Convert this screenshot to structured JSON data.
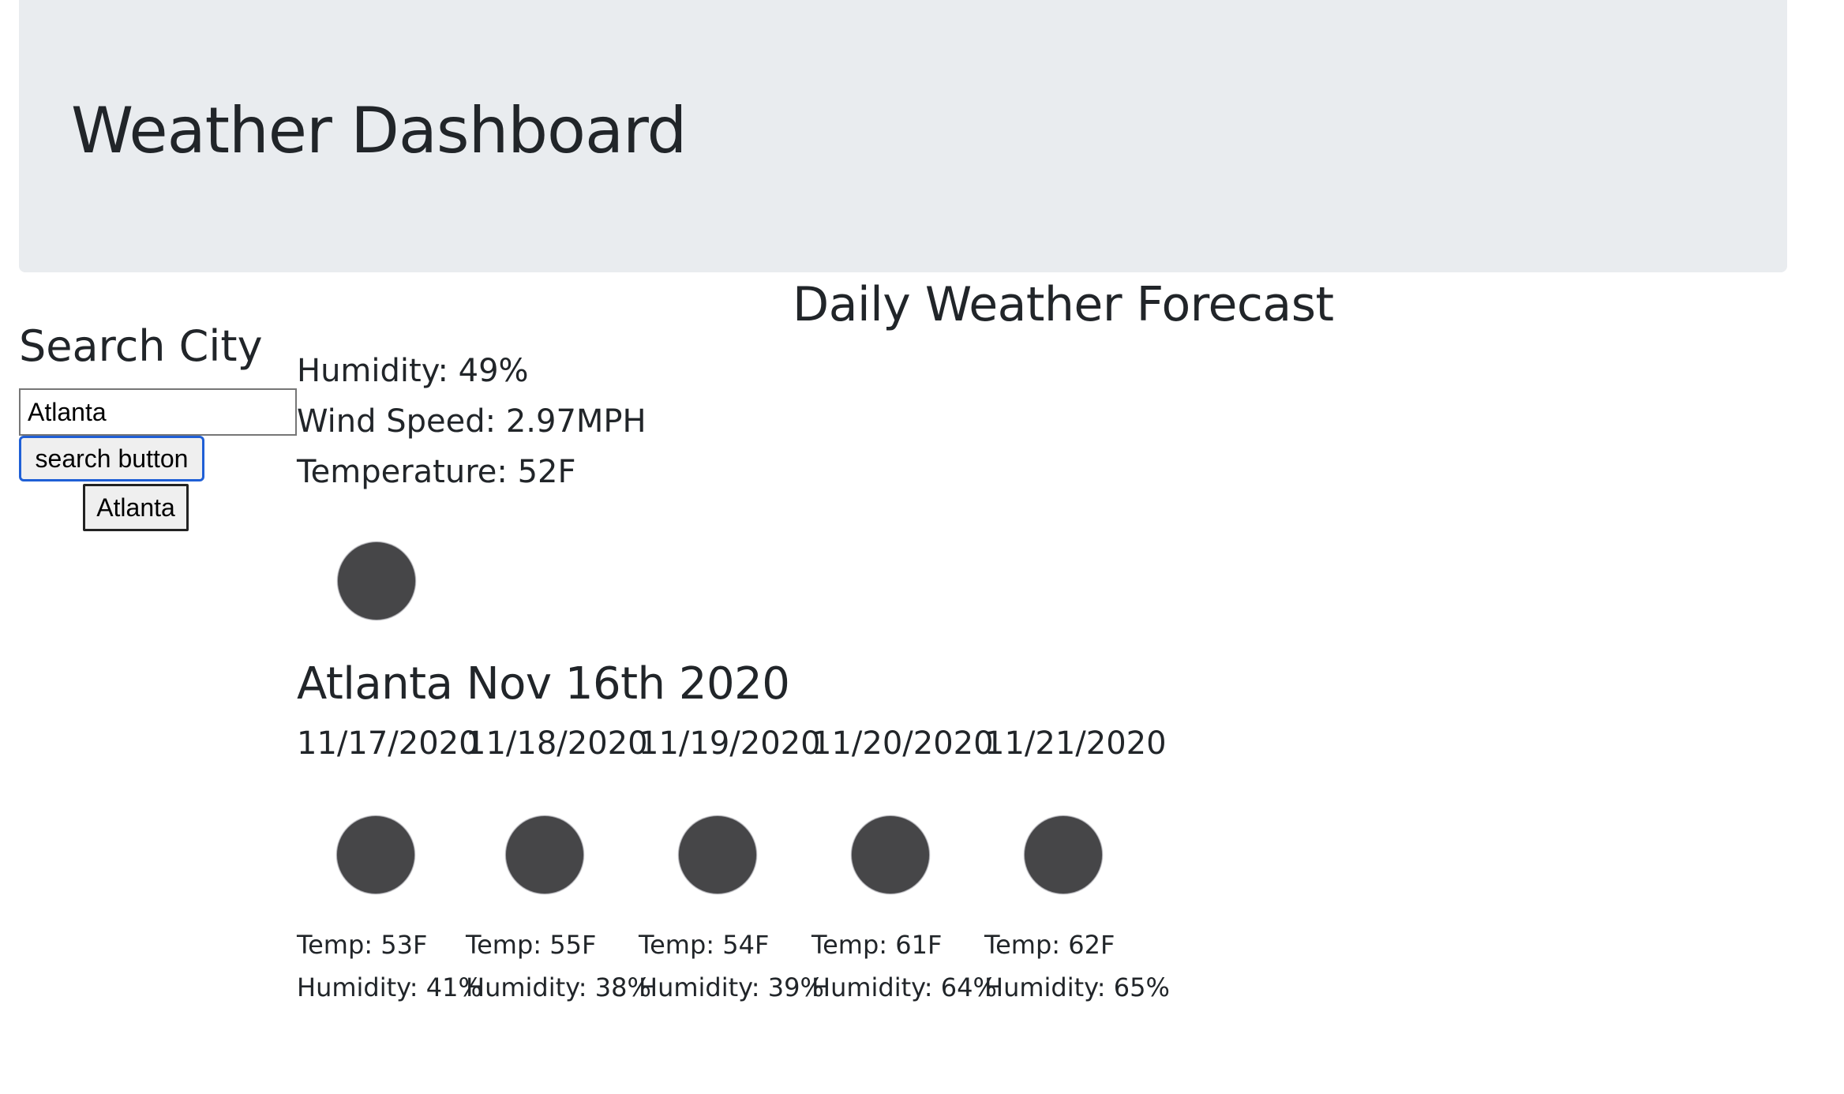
{
  "header": {
    "title": "Weather Dashboard"
  },
  "forecast_heading": "Daily Weather Forecast",
  "search": {
    "heading": "Search City",
    "input_value": "Atlanta",
    "button_label": "search button",
    "history": [
      "Atlanta"
    ]
  },
  "current": {
    "humidity": "Humidity: 49%",
    "wind": "Wind Speed: 2.97MPH",
    "temperature": "Temperature: 52F",
    "icon": "weather-icon",
    "city_date": "Atlanta Nov 16th 2020"
  },
  "forecast": [
    {
      "date": "11/17/2020",
      "icon": "weather-icon",
      "temp": "Temp: 53F",
      "humidity": "Humidity: 41%"
    },
    {
      "date": "11/18/2020",
      "icon": "weather-icon",
      "temp": "Temp: 55F",
      "humidity": "Humidity: 38%"
    },
    {
      "date": "11/19/2020",
      "icon": "weather-icon",
      "temp": "Temp: 54F",
      "humidity": "Humidity: 39%"
    },
    {
      "date": "11/20/2020",
      "icon": "weather-icon",
      "temp": "Temp: 61F",
      "humidity": "Humidity: 64%"
    },
    {
      "date": "11/21/2020",
      "icon": "weather-icon",
      "temp": "Temp: 62F",
      "humidity": "Humidity: 65%"
    }
  ],
  "colors": {
    "header_bg": "#e9ecef",
    "text": "#212529",
    "icon_fill": "#464648",
    "focus_border": "#1f5fd6"
  }
}
